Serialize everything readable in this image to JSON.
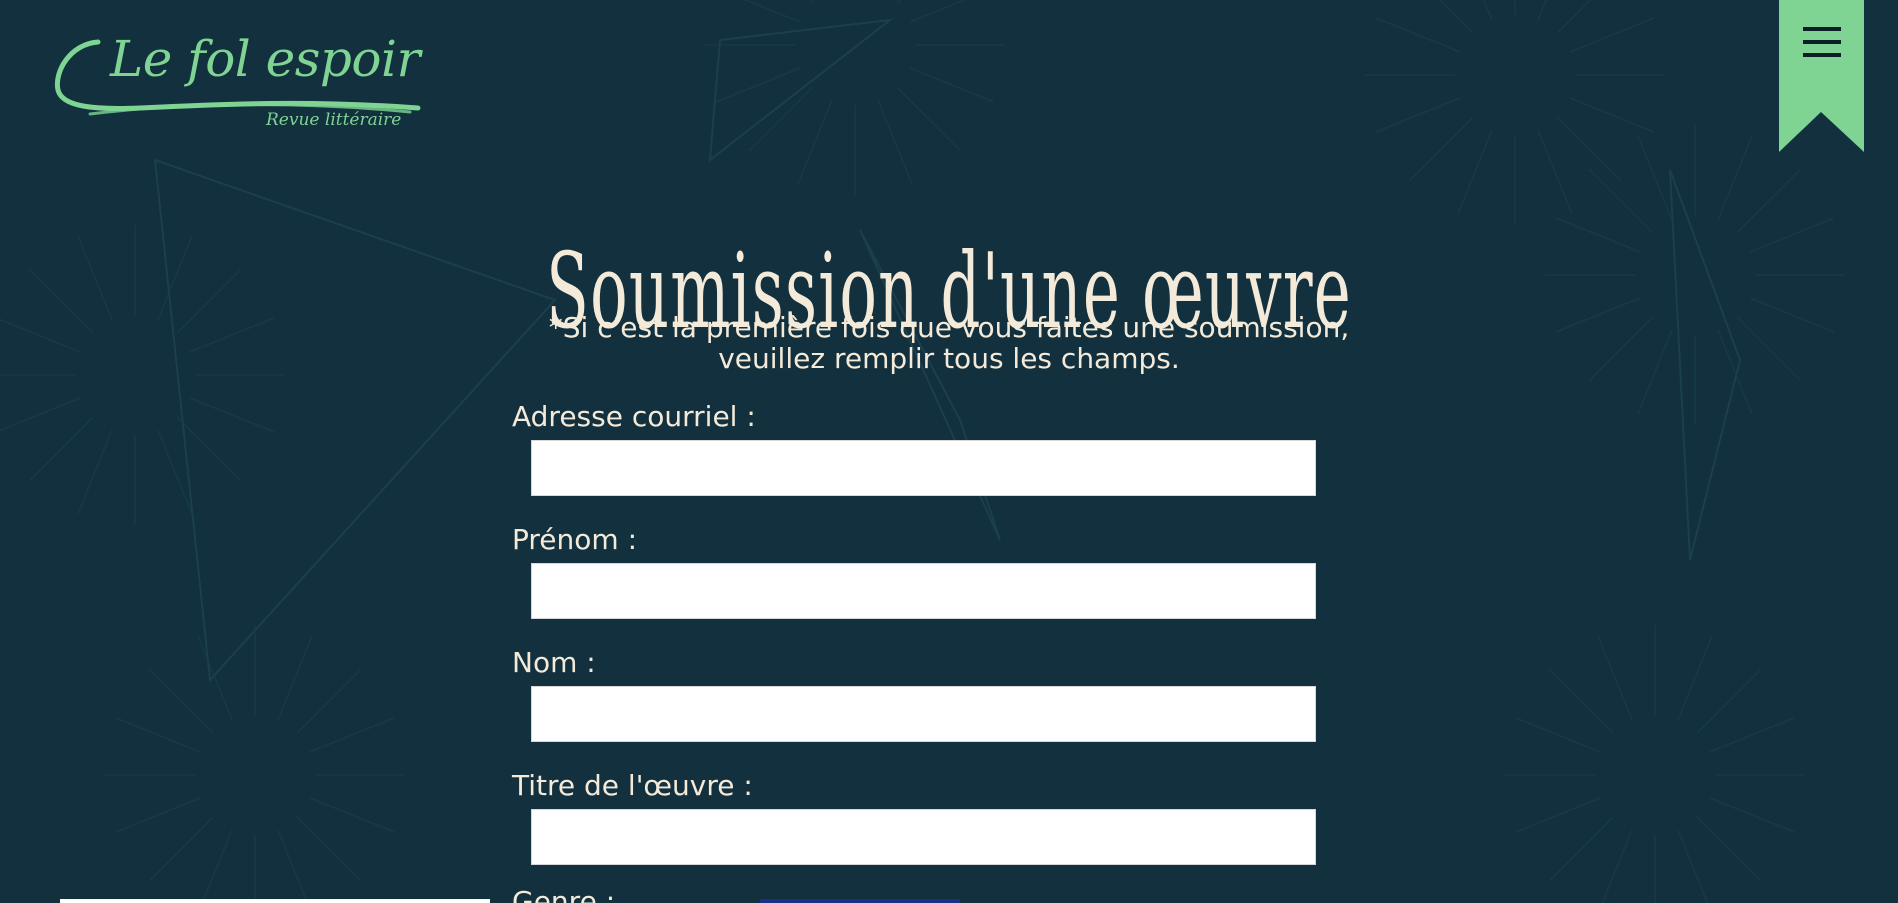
{
  "brand": {
    "name": "Le fol espoir",
    "tagline": "Revue littéraire",
    "accent_color": "#7fd393",
    "background_color": "#12303d",
    "text_color": "#f4ead9"
  },
  "menu": {
    "icon": "hamburger-menu-icon"
  },
  "page": {
    "title": "Soumission d'une œuvre",
    "notice_line1": "*Si c'est la première fois que vous faites une soumission,",
    "notice_line2": "veuillez remplir tous les champs."
  },
  "form": {
    "fields": [
      {
        "label": "Adresse courriel :",
        "value": "",
        "placeholder": ""
      },
      {
        "label": "Prénom :",
        "value": "",
        "placeholder": ""
      },
      {
        "label": "Nom :",
        "value": "",
        "placeholder": ""
      },
      {
        "label": "Titre de l'œuvre :",
        "value": "",
        "placeholder": ""
      }
    ],
    "next_label_partial": "Genre :"
  }
}
